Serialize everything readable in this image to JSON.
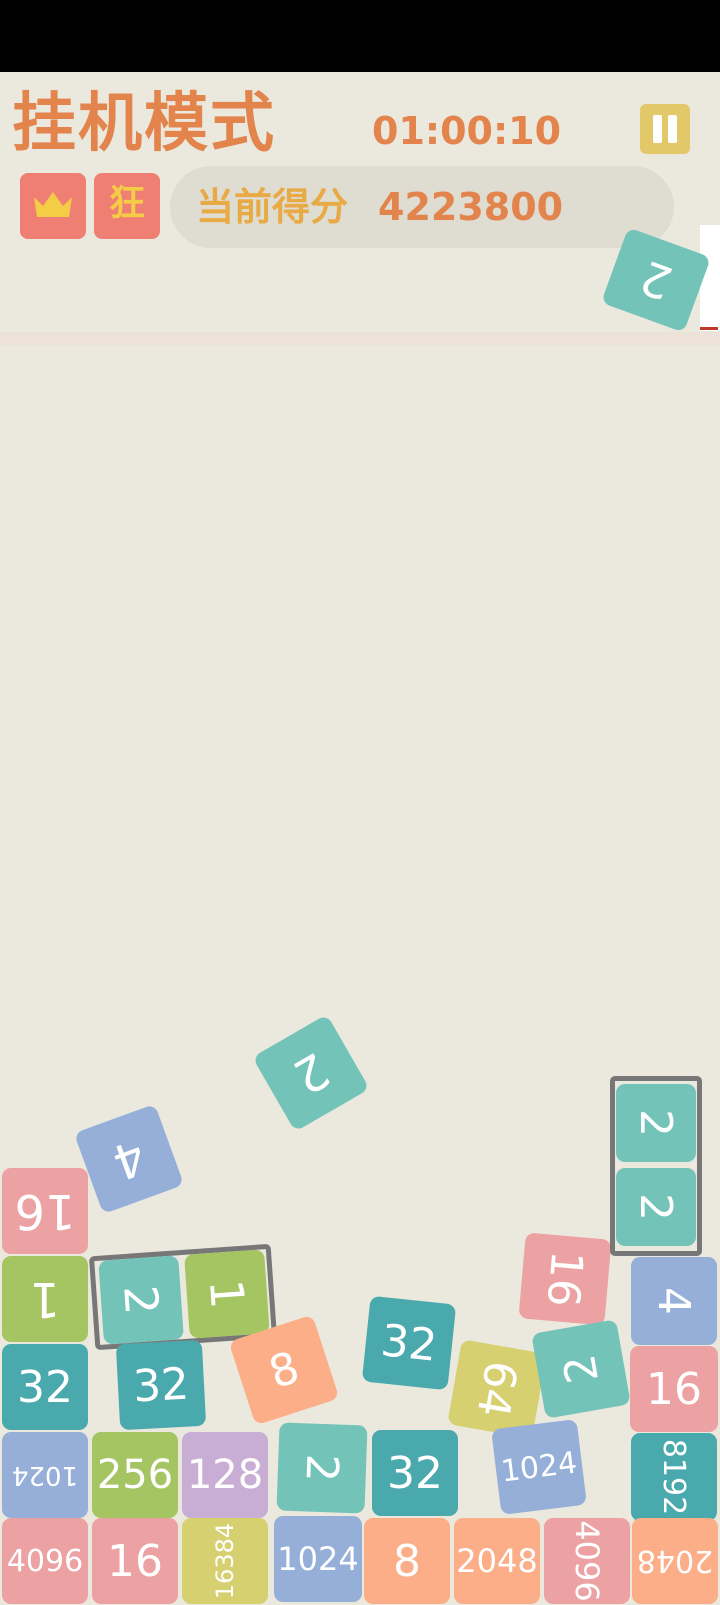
{
  "header": {
    "title": "挂机模式",
    "timer": "01:00:10",
    "mode_badge": "狂",
    "score_label": "当前得分",
    "score_value": "4223800"
  },
  "icons": {
    "crown": "crown-icon",
    "pause": "pause-icon"
  },
  "colors": {
    "accent": "#e2844c",
    "background": "#ebe9de",
    "tile_2": "#74c3b9",
    "tile_4": "#96afd9",
    "tile_8": "#fbae87",
    "tile_16": "#eca1a2",
    "tile_32": "#4aa9ad",
    "tile_64": "#d7d070",
    "tile_128": "#c8add5",
    "tile_256": "#a5c462"
  },
  "tiles": {
    "falling_top": "2",
    "floating_2": "2",
    "floating_4": "4",
    "left_16": "16",
    "left_1": "1",
    "pair_left_2": "2",
    "pair_left_1": "1",
    "left_32": "32",
    "mid_32": "32",
    "mid_8": "8",
    "center_32": "32",
    "r_16": "16",
    "r_64": "64",
    "r_2": "2",
    "stack_2_top": "2",
    "stack_2_bottom": "2",
    "far_4": "4",
    "far_16": "16",
    "row2_1024": "1024",
    "row2_256": "256",
    "row2_128": "128",
    "row2_2": "2",
    "row2_32": "32",
    "row2_1024b": "1024",
    "row2_8192": "8192",
    "row1_4096": "4096",
    "row1_16": "16",
    "row1_16384": "16384",
    "row1_1024": "1024",
    "row1_8": "8",
    "row1_2048": "2048",
    "row1_4096b": "4096",
    "row1_2048b": "2048"
  }
}
